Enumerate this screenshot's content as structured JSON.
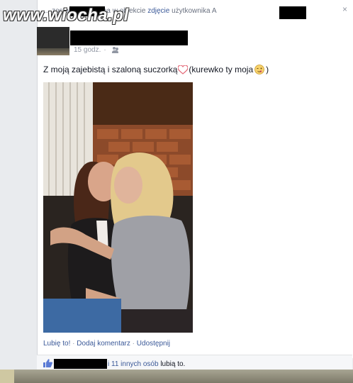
{
  "watermark": {
    "text": "www.wiocha.pl"
  },
  "header": {
    "tag_prefix": "... została oznaczona w obiekcie",
    "tag_link": "zdjęcie",
    "tag_suffix": "użytkownika A",
    "close_glyph": "×"
  },
  "post": {
    "time": "15 godz.",
    "privacy_icon": "people-icon",
    "message_part1": "Z moją zajebistą i szaloną suczorką",
    "message_part2": "(kurewko ty moja",
    "message_part3": ")",
    "heart_icon": "heart-emoticon",
    "wink_icon": "wink-emoticon"
  },
  "actions": {
    "like": "Lubię to!",
    "separator": "·",
    "comment": "Dodaj komentarz",
    "share": "Udostępnij"
  },
  "likes": {
    "icon": "thumbs-up-icon",
    "others_link": "i 11 innych osób",
    "suffix": "lubią to."
  },
  "colors": {
    "link": "#3b5998",
    "meta": "#9197a3",
    "background": "#e9ebee"
  }
}
